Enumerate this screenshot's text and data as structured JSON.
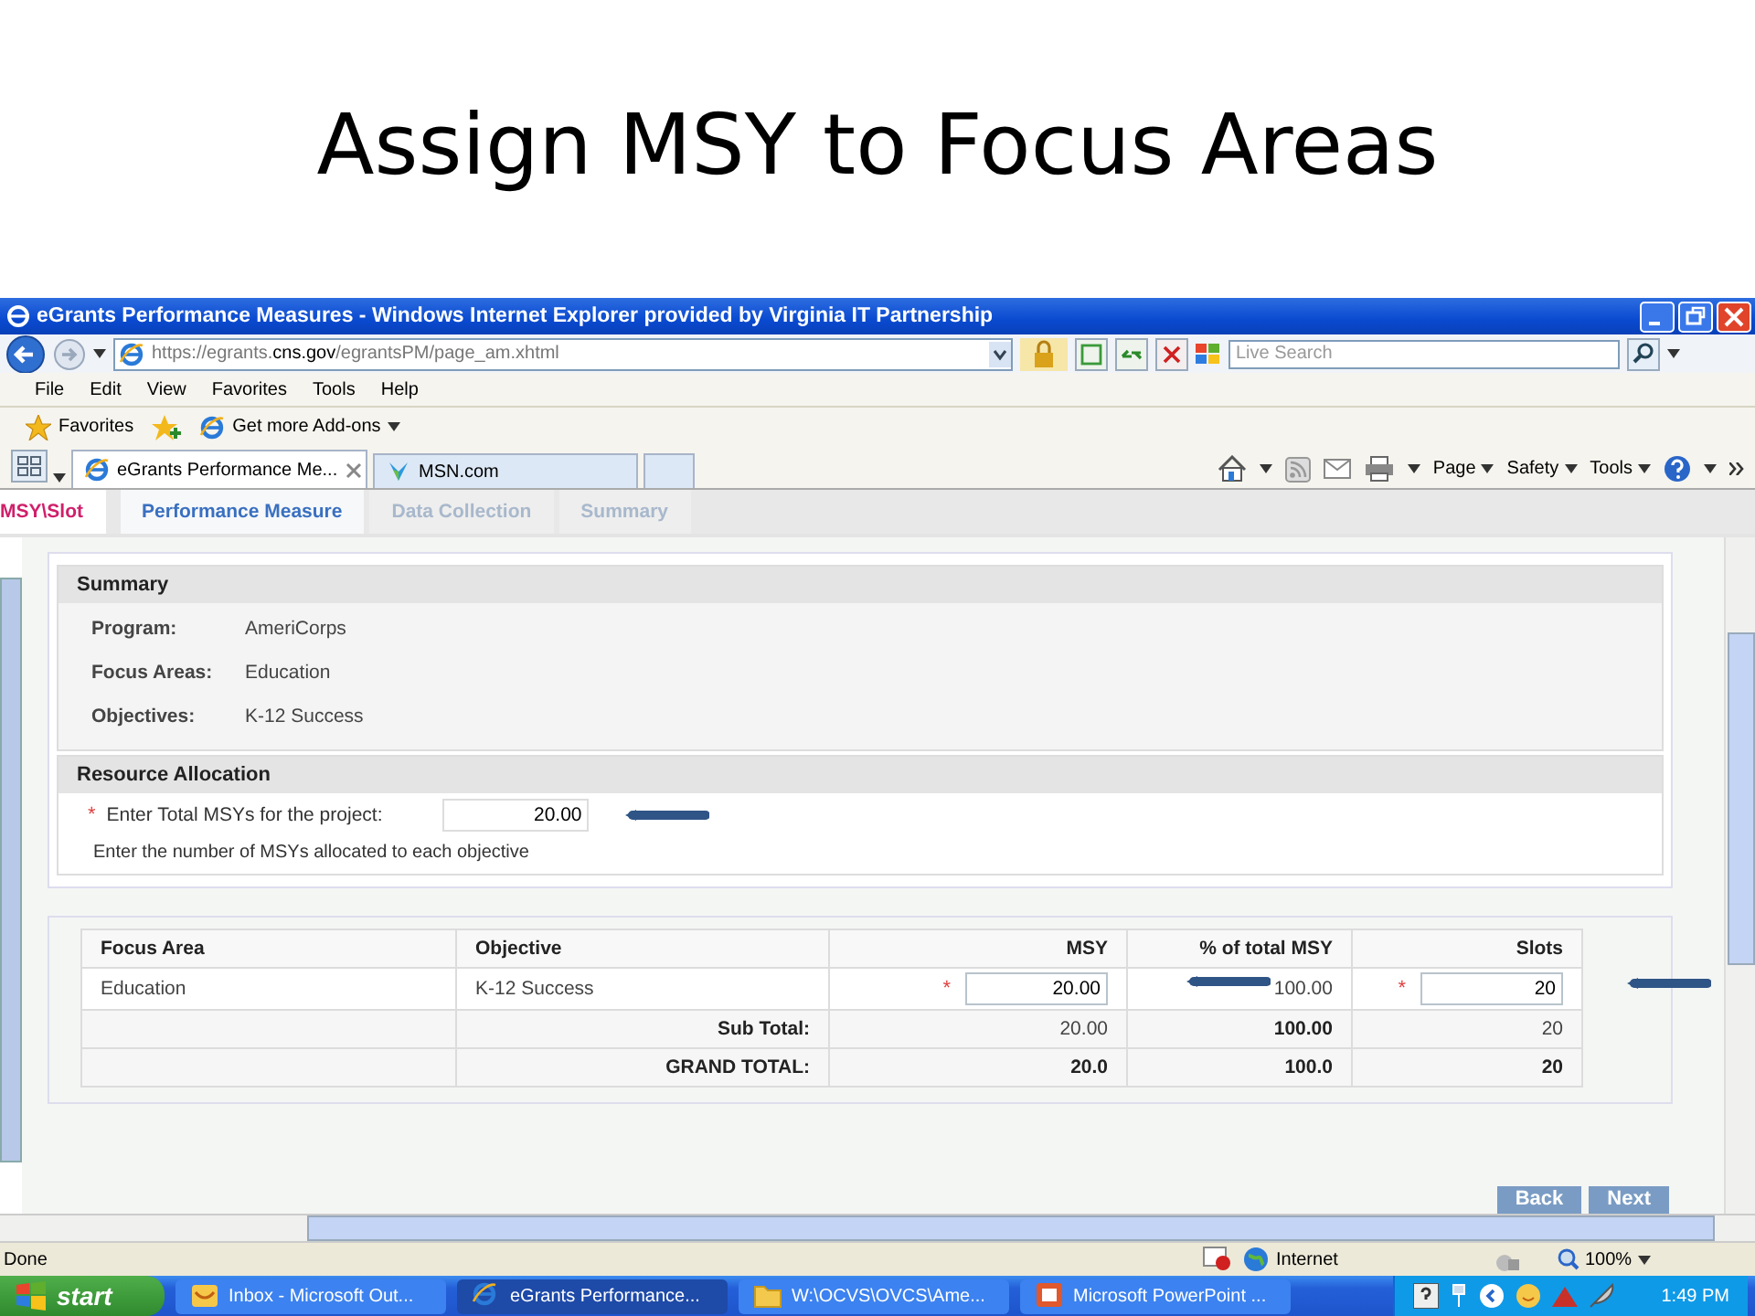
{
  "slide_title": "Assign MSY to Focus Areas",
  "browser": {
    "title": "eGrants Performance Measures - Windows Internet Explorer provided by Virginia IT Partnership",
    "address": {
      "prefix": "https://egrants.",
      "domain": "cns.gov",
      "path": "/egrantsPM/page_am.xhtml"
    },
    "search": {
      "placeholder": "Live Search"
    },
    "menu": [
      "File",
      "Edit",
      "View",
      "Favorites",
      "Tools",
      "Help"
    ],
    "favorites_bar": {
      "favorites": "Favorites",
      "addons": "Get more Add-ons"
    },
    "tabs": [
      {
        "label": "eGrants Performance Me...",
        "selected": true
      },
      {
        "label": "MSN.com",
        "selected": false
      }
    ],
    "command_bar": [
      "Page",
      "Safety",
      "Tools"
    ]
  },
  "page_tabs": [
    {
      "label": "MSY\\Slot",
      "selected": true,
      "disabled": false
    },
    {
      "label": "Performance Measure",
      "selected": false,
      "disabled": false
    },
    {
      "label": "Data Collection",
      "selected": false,
      "disabled": true
    },
    {
      "label": "Summary",
      "selected": false,
      "disabled": true
    }
  ],
  "summary": {
    "heading": "Summary",
    "fields": [
      {
        "label": "Program:",
        "value": "AmeriCorps"
      },
      {
        "label": "Focus Areas:",
        "value": "Education"
      },
      {
        "label": "Objectives:",
        "value": "K-12 Success"
      }
    ]
  },
  "resource_allocation": {
    "heading": "Resource Allocation",
    "required_mark": "*",
    "label": "Enter Total MSYs for the project:",
    "value": "20.00",
    "hint": "Enter the number of MSYs allocated to each objective"
  },
  "table": {
    "columns": [
      "Focus Area",
      "Objective",
      "MSY",
      "% of total MSY",
      "Slots"
    ],
    "rows": [
      {
        "kind": "data",
        "cells": [
          {
            "kind": "text",
            "text": "Education"
          },
          {
            "kind": "text",
            "text": "K-12 Success"
          },
          {
            "kind": "input",
            "required_mark": "*",
            "text": "20.00"
          },
          {
            "kind": "text",
            "text": "100.00"
          },
          {
            "kind": "input",
            "required_mark": "*",
            "text": "20"
          }
        ]
      },
      {
        "kind": "subtotal",
        "cells": [
          {
            "kind": "text",
            "text": ""
          },
          {
            "kind": "label",
            "text": "Sub Total:"
          },
          {
            "kind": "text",
            "text": "20.00"
          },
          {
            "kind": "bold",
            "text": "100.00"
          },
          {
            "kind": "text",
            "text": "20"
          }
        ]
      },
      {
        "kind": "total",
        "cells": [
          {
            "kind": "text",
            "text": ""
          },
          {
            "kind": "label",
            "text": "GRAND TOTAL:"
          },
          {
            "kind": "bold",
            "text": "20.0"
          },
          {
            "kind": "bold",
            "text": "100.0"
          },
          {
            "kind": "bold",
            "text": "20"
          }
        ]
      }
    ]
  },
  "buttons": [
    "Back",
    "Next"
  ],
  "status_bar": {
    "text": "Done",
    "zone": "Internet",
    "zoom": "100%"
  },
  "taskbar": {
    "start": "start",
    "items": [
      {
        "label": "Inbox - Microsoft Out...",
        "selected": false
      },
      {
        "label": "eGrants Performance...",
        "selected": true
      },
      {
        "label": "W:\\OCVS\\OVCS\\Ame...",
        "selected": false
      },
      {
        "label": "Microsoft PowerPoint ...",
        "selected": false
      }
    ],
    "clock": "1:49 PM"
  }
}
